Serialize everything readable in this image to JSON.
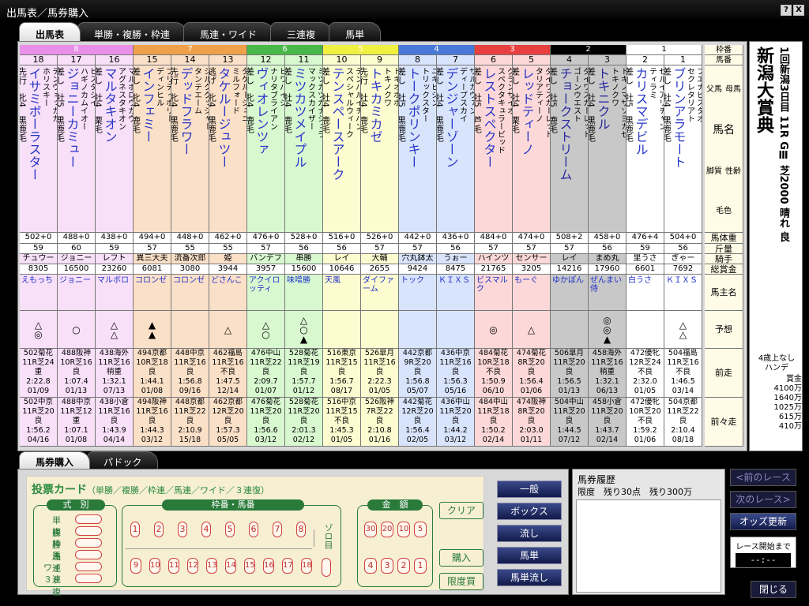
{
  "window": {
    "title": "出馬表／馬券購入",
    "help": "?",
    "close": "X"
  },
  "tabs": [
    "出馬表",
    "単勝・複勝・枠連",
    "馬連・ワイド",
    "三連複",
    "馬単"
  ],
  "race": {
    "name": "新潟大賞典",
    "info": "1回新潟3日目 11R GⅢ 芝2000 晴れ 良",
    "conditions": "4歳上なし\nハンデ",
    "prize_label": "賞金",
    "prizes": [
      "4100万",
      "1640万",
      "1025万",
      "615万",
      "410万"
    ]
  },
  "labels": {
    "waku": "枠番",
    "umaban": "馬番",
    "pedigree_top": "父馬",
    "pedigree_bottom": "母馬",
    "name": "馬名",
    "sex_age": "性齢",
    "style": "脚質",
    "color": "毛色",
    "weight": "馬体重",
    "kinryo": "斤量",
    "jockey": "騎手",
    "prize": "総賞金",
    "owner": "馬主名",
    "yoso": "予想",
    "prev": "前走",
    "prev2": "前々走"
  },
  "waku_colors": {
    "8": {
      "bg": "#e890e8",
      "col": "#f8e0f8"
    },
    "7": {
      "bg": "#f0a048",
      "col": "#fbe0c8"
    },
    "6": {
      "bg": "#48b848",
      "col": "#d8f8d0"
    },
    "5": {
      "bg": "#f0f040",
      "col": "#fcfcd0"
    },
    "4": {
      "bg": "#4878d8",
      "col": "#d8e4fc"
    },
    "3": {
      "bg": "#e84040",
      "col": "#fcd8d8"
    },
    "2": {
      "bg": "#000000",
      "col": "#c8c8c8"
    },
    "1": {
      "bg": "#ffffff",
      "col": "#ffffff"
    }
  },
  "waku_groups": [
    {
      "waku": "8",
      "span": 3
    },
    {
      "waku": "7",
      "span": 3
    },
    {
      "waku": "6",
      "span": 2
    },
    {
      "waku": "5",
      "span": 2
    },
    {
      "waku": "4",
      "span": 2
    },
    {
      "waku": "3",
      "span": 2
    },
    {
      "waku": "2",
      "span": 2
    },
    {
      "waku": "1",
      "span": 2
    }
  ],
  "horses": [
    {
      "num": "18",
      "waku": "8",
      "sire": "テンウォッカカ",
      "dam": "ホリスキー",
      "name": "イサミボーラスター",
      "style": "先行",
      "sexage": "牝4",
      "color": "黒鹿毛",
      "weight": "502+0",
      "kinryo": "59",
      "jockey": "チュウー",
      "prize": "8305",
      "owner": "えもっち",
      "yoso": [
        "△",
        "◎"
      ],
      "prev": [
        "502菊花",
        "11R芝24",
        "重",
        "2:22.8",
        "01/09"
      ],
      "prev2": [
        "502中京",
        "11R芝20",
        "良",
        "1:56.2",
        "04/16"
      ]
    },
    {
      "num": "17",
      "waku": "8",
      "sire": "ビスタジイ",
      "dam": "ハギノカムイオー",
      "name": "ジョニーカミュー",
      "style": "差し",
      "sexage": "牡5",
      "color": "黒鹿毛",
      "weight": "488+0",
      "kinryo": "60",
      "jockey": "ジョニー",
      "prize": "16500",
      "owner": "ジョニー",
      "yoso": [
        "○"
      ],
      "prev": [
        "488阪神",
        "10R芝16",
        "良",
        "1:07.4",
        "01/13"
      ],
      "prev2": [
        "488中京",
        "11R芝12",
        "重",
        "1:07.1",
        "01/08"
      ]
    },
    {
      "num": "16",
      "waku": "8",
      "sire": "マルボロウガウ",
      "dam": "アグネスタキオン",
      "name": "マルタキオン",
      "style": "差し",
      "sexage": "牡4",
      "color": "栗毛",
      "weight": "438+0",
      "kinryo": "59",
      "jockey": "レフト",
      "prize": "23260",
      "owner": "マルボロ",
      "yoso": [
        "△",
        "△"
      ],
      "prev": [
        "438海外",
        "11R芝16",
        "稍重",
        "1:32.1",
        "07/13"
      ],
      "prev2": [
        "438小倉",
        "11R芝16",
        "良",
        "1:43.9",
        "04/14"
      ]
    },
    {
      "num": "15",
      "waku": "7",
      "sire": "ブリティポリー",
      "dam": "ディンヒル",
      "name": "インフェミー",
      "style": "差し",
      "sexage": "牝4",
      "color": "鹿毛",
      "weight": "494+0",
      "kinryo": "57",
      "jockey": "異三大夫",
      "prize": "6081",
      "owner": "コロンゼ",
      "yoso": [
        "▲",
        "▲"
      ],
      "prev": [
        "494京都",
        "10R芝18",
        "良",
        "1:44.1",
        "01/08"
      ],
      "prev2": [
        "494阪神",
        "11R芝16",
        "良",
        "1:44.3",
        "03/12"
      ]
    },
    {
      "num": "14",
      "waku": "7",
      "sire": "シルクグッシャー",
      "dam": "タンテエーム",
      "name": "デッドフラワー",
      "style": "先行",
      "sexage": "牝4",
      "color": "黒鹿毛",
      "weight": "448+0",
      "kinryo": "55",
      "jockey": "流番次郎",
      "prize": "3080",
      "owner": "コロンゼ",
      "yoso": [],
      "prev": [
        "448中京",
        "11R芝16",
        "良",
        "1:56.8",
        "09/16"
      ],
      "prev2": [
        "448京都",
        "11R芝22",
        "良",
        "2:10.9",
        "15/18"
      ]
    },
    {
      "num": "13",
      "waku": "7",
      "sire": "タケルージュニ",
      "dam": "ミルフォード",
      "name": "タケルージュツー",
      "style": "逃げ",
      "sexage": "牝4",
      "color": "黒鹿毛",
      "weight": "462+0",
      "kinryo": "55",
      "jockey": "姫",
      "prize": "3944",
      "owner": "どさんこ",
      "yoso": [
        "△"
      ],
      "prev": [
        "462福島",
        "11R芝16",
        "不良",
        "1:47.5",
        "12/14"
      ],
      "prev2": [
        "462京都",
        "12R芝20",
        "良",
        "1:57.3",
        "05/05"
      ]
    },
    {
      "num": "12",
      "waku": "6",
      "sire": "ビワハイジ",
      "dam": "ナリタブライアン",
      "name": "ヴィオレンツァ",
      "style": "差し",
      "sexage": "牝4",
      "color": "鹿毛",
      "weight": "476+0",
      "kinryo": "57",
      "jockey": "バンデフ",
      "prize": "3957",
      "owner": "アクイロッティ",
      "yoso": [
        "△",
        "○"
      ],
      "prev": [
        "476中山",
        "11R芝22",
        "良",
        "2:09.7",
        "01/07"
      ],
      "prev2": [
        "476菊花",
        "11R芝20",
        "良",
        "1:56.6",
        "03/12"
      ]
    },
    {
      "num": "11",
      "waku": "6",
      "sire": "ミツカツガナシュラ",
      "dam": "マックスカイザー",
      "name": "ミツカツメイプル",
      "style": "差し",
      "sexage": "牡4",
      "color": "鹿毛",
      "weight": "528+0",
      "kinryo": "56",
      "jockey": "串勝",
      "prize": "15600",
      "owner": "味噌勝",
      "yoso": [
        "△",
        "○",
        "▲"
      ],
      "prev": [
        "528菊花",
        "11R芝19",
        "良",
        "1:57.7",
        "01/12"
      ],
      "prev2": [
        "528菊花",
        "11R芝20",
        "良",
        "2:01.3",
        "02/12"
      ]
    },
    {
      "num": "10",
      "waku": "5",
      "sire": "テンハルイチバン",
      "dam": "スペシャルウィーク",
      "name": "テンスペースアーク",
      "style": "差し",
      "sexage": "牡4",
      "color": "鹿毛",
      "weight": "516+0",
      "kinryo": "56",
      "jockey": "レイ",
      "prize": "10646",
      "owner": "天風",
      "yoso": [],
      "prev": [
        "516東京",
        "11R芝15",
        "良",
        "1:56.7",
        "08/17"
      ],
      "prev2": [
        "516中京",
        "11R芝15",
        "不良",
        "1:45.3",
        "01/05"
      ]
    },
    {
      "num": "9",
      "waku": "5",
      "sire": "トキオポポ",
      "dam": "トキノクワ",
      "name": "トキカミカゼ",
      "style": "先行",
      "sexage": "牡4",
      "color": "鹿毛",
      "weight": "526+0",
      "kinryo": "57",
      "jockey": "大輔",
      "prize": "2655",
      "owner": "ダイファーム",
      "yoso": [],
      "prev": [
        "526皐月",
        "11R芝16",
        "良",
        "2:22.3",
        "01/05"
      ],
      "prev2": [
        "526阪神",
        "7R芝22",
        "良",
        "2:10.8",
        "01/16"
      ]
    },
    {
      "num": "8",
      "waku": "4",
      "sire": "ユキビジン",
      "dam": "トリックスター",
      "name": "トークポリンキー",
      "style": "差し",
      "sexage": "牡5",
      "color": "黒鹿毛",
      "weight": "442+0",
      "kinryo": "57",
      "jockey": "穴丸鉢太",
      "prize": "9424",
      "owner": "トック",
      "yoso": [],
      "prev": [
        "442京都",
        "9R芝20",
        "良",
        "1:56.8",
        "05/07"
      ],
      "prev2": [
        "442菊花",
        "12R芝20",
        "良",
        "1:56.4",
        "02/05"
      ]
    },
    {
      "num": "7",
      "waku": "4",
      "sire": "ザルカヴァン",
      "dam": "ディープスカイ",
      "name": "デンジャーゾーン",
      "style": "差し",
      "sexage": "牡4",
      "color": "黒鹿毛",
      "weight": "436+0",
      "kinryo": "56",
      "jockey": "うぉー",
      "prize": "8475",
      "owner": "ＫＩＸＳ",
      "yoso": [],
      "prev": [
        "436中京",
        "11R芝16",
        "良",
        "1:56.3",
        "05/16"
      ],
      "prev2": [
        "436中山",
        "11R芝20",
        "良",
        "1:44.2",
        "03/12"
      ]
    },
    {
      "num": "6",
      "waku": "3",
      "sire": "グランザイオ",
      "dam": "スペクタキュラービッド",
      "name": "レストスペクター",
      "style": "差し",
      "sexage": "牡5",
      "color": "芦毛",
      "weight": "484+0",
      "kinryo": "57",
      "jockey": "ハインツ",
      "prize": "21765",
      "owner": "ビスマルク",
      "yoso": [
        "◎"
      ],
      "prev": [
        "484菊花",
        "10R芝18",
        "不良",
        "1:50.9",
        "06/10"
      ],
      "prev2": [
        "484中山",
        "11R芝18",
        "良",
        "1:50.2",
        "02/14"
      ]
    },
    {
      "num": "5",
      "waku": "3",
      "sire": "ダイワスカーレット",
      "dam": "タリアティーノ",
      "name": "レッドティーノ",
      "style": "差し",
      "sexage": "牡4",
      "color": "栗毛",
      "weight": "474+0",
      "kinryo": "57",
      "jockey": "センサー",
      "prize": "3205",
      "owner": "もーぐ",
      "yoso": [
        "△"
      ],
      "prev": [
        "474菊花",
        "8R芝20",
        "良",
        "1:56.4",
        "01/06"
      ],
      "prev2": [
        "474阪神",
        "8R芝20",
        "良",
        "2:03.0",
        "01/11"
      ]
    },
    {
      "num": "4",
      "waku": "2",
      "sire": "ダイワスカーレット",
      "dam": "ゴーンウエスト",
      "name": "チョークストリーム",
      "style": "差し",
      "sexage": "牡5",
      "color": "鹿毛",
      "weight": "508+2",
      "kinryo": "57",
      "jockey": "レイ",
      "prize": "14216",
      "owner": "ゆかぽん",
      "yoso": [],
      "prev": [
        "506皐月",
        "11R芝20",
        "良",
        "1:56.5",
        "01/13"
      ],
      "prev2": [
        "504中山",
        "11R芝20",
        "良",
        "1:44.5",
        "07/12"
      ]
    },
    {
      "num": "3",
      "waku": "2",
      "sire": "トキノマザソヨカゼ",
      "dam": "トキノクワ",
      "name": "トキニクル",
      "style": "差し",
      "sexage": "牡4",
      "color": "黒鹿毛",
      "weight": "458+0",
      "kinryo": "56",
      "jockey": "まめ丸",
      "prize": "17960",
      "owner": "ぜんまい侍",
      "yoso": [
        "◎",
        "◎",
        "▲"
      ],
      "prev": [
        "458海外",
        "11R芝16",
        "稍重",
        "1:32.1",
        "06/13"
      ],
      "prev2": [
        "458小倉",
        "11R芝20",
        "良",
        "1:43.7",
        "02/14"
      ]
    },
    {
      "num": "2",
      "waku": "1",
      "sire": "ゼルイアリチャン",
      "dam": "ティラミ",
      "name": "カリスマデビル",
      "style": "差し",
      "sexage": "牡5",
      "color": "黒鹿毛",
      "weight": "476+4",
      "kinryo": "59",
      "jockey": "里うさ",
      "prize": "6601",
      "owner": "白うさ",
      "yoso": [],
      "prev": [
        "472優牝",
        "12R芝24",
        "不良",
        "2:32.0",
        "01/05"
      ],
      "prev2": [
        "472優牝",
        "10R芝20",
        "不良",
        "1:59.2",
        "01/06"
      ]
    },
    {
      "num": "1",
      "waku": "1",
      "sire": "ブエナビスタオ",
      "dam": "セクレタリアト",
      "name": "ブリンアラモート",
      "style": "差し",
      "sexage": "牡4",
      "color": "黒鹿毛",
      "weight": "504+0",
      "kinryo": "56",
      "jockey": "ぎゃー",
      "prize": "7692",
      "owner": "ＫＩＸＳ",
      "yoso": [
        "△",
        "△"
      ],
      "prev": [
        "504福島",
        "11R芝16",
        "不良",
        "1:46.5",
        "03/14"
      ],
      "prev2": [
        "504京都",
        "11R芝22",
        "良",
        "2:10.4",
        "08/18"
      ]
    }
  ],
  "bottom_tabs": [
    "馬券購入",
    "パドック"
  ],
  "ticket": {
    "title": "投票カード",
    "subtitle": "（単勝／複勝／枠連／馬連／ワイド／３連復）",
    "shiki_header": "式　別",
    "shiki": [
      "単　勝",
      "複　勝",
      "枠　連",
      "馬　連",
      "ワイド",
      "３連複"
    ],
    "umaban_header": "枠番・馬番",
    "nums_top": [
      "1",
      "2",
      "3",
      "4",
      "5",
      "6",
      "7",
      "8"
    ],
    "nums_bottom": [
      "9",
      "10",
      "11",
      "12",
      "13",
      "14",
      "15",
      "16",
      "17",
      "18"
    ],
    "zorome": "ゾロ目",
    "amount_header": "金　額",
    "amounts_top": [
      "30",
      "20",
      "10",
      "5"
    ],
    "amounts_bottom": [
      "4",
      "3",
      "2",
      "1"
    ],
    "clear": "クリア",
    "buy": "購入",
    "limit_buy": "限度買"
  },
  "bet_buttons": [
    "一般",
    "ボックス",
    "流し",
    "馬単",
    "馬単流し"
  ],
  "history": {
    "title": "馬券履歴",
    "limit": "限度　残り30点　残り300万"
  },
  "nav": {
    "prev": "<前のレース",
    "next": "次のレース>",
    "odds": "オッズ更新",
    "countdown_label": "レース開始まで",
    "countdown": "--:--",
    "close": "閉じる"
  }
}
